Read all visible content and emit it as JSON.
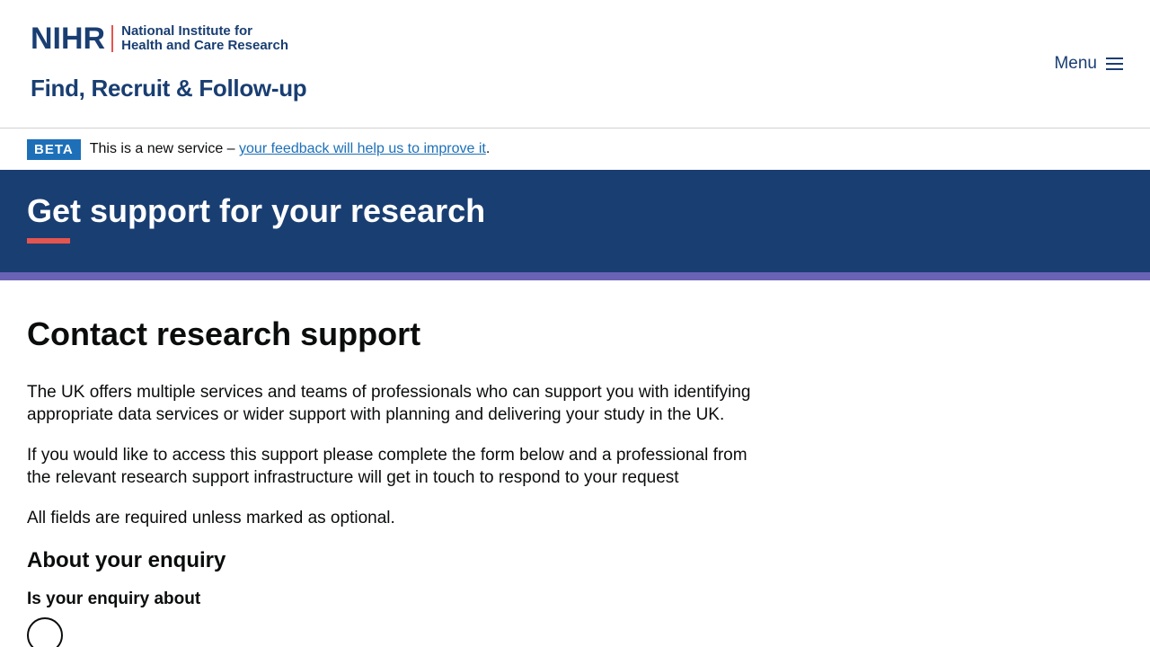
{
  "header": {
    "logo_mark": "NIHR",
    "logo_line1": "National Institute for",
    "logo_line2": "Health and Care Research",
    "service_name": "Find, Recruit & Follow-up",
    "menu_label": "Menu"
  },
  "beta": {
    "tag": "BETA",
    "text_before": "This is a new service – ",
    "link": "your feedback will help us to improve it",
    "text_after": "."
  },
  "hero": {
    "title": "Get support for your research"
  },
  "main": {
    "heading": "Contact research support",
    "paragraph1": "The UK offers multiple services and teams of professionals who can support you with identifying appropriate data services or wider support with planning and delivering your study in the UK.",
    "paragraph2": "If you would like to access this support please complete the form below and a professional from the relevant research support infrastructure will get in touch to respond to your request",
    "paragraph3": "All fields are required unless marked as optional.",
    "section_heading": "About your enquiry",
    "question_label": "Is your enquiry about"
  },
  "colors": {
    "brand_navy": "#193e72",
    "accent_red": "#e5554f",
    "stripe_purple": "#6a63b5",
    "link_blue": "#1d70b8"
  },
  "icons": {
    "menu": "hamburger-icon"
  }
}
